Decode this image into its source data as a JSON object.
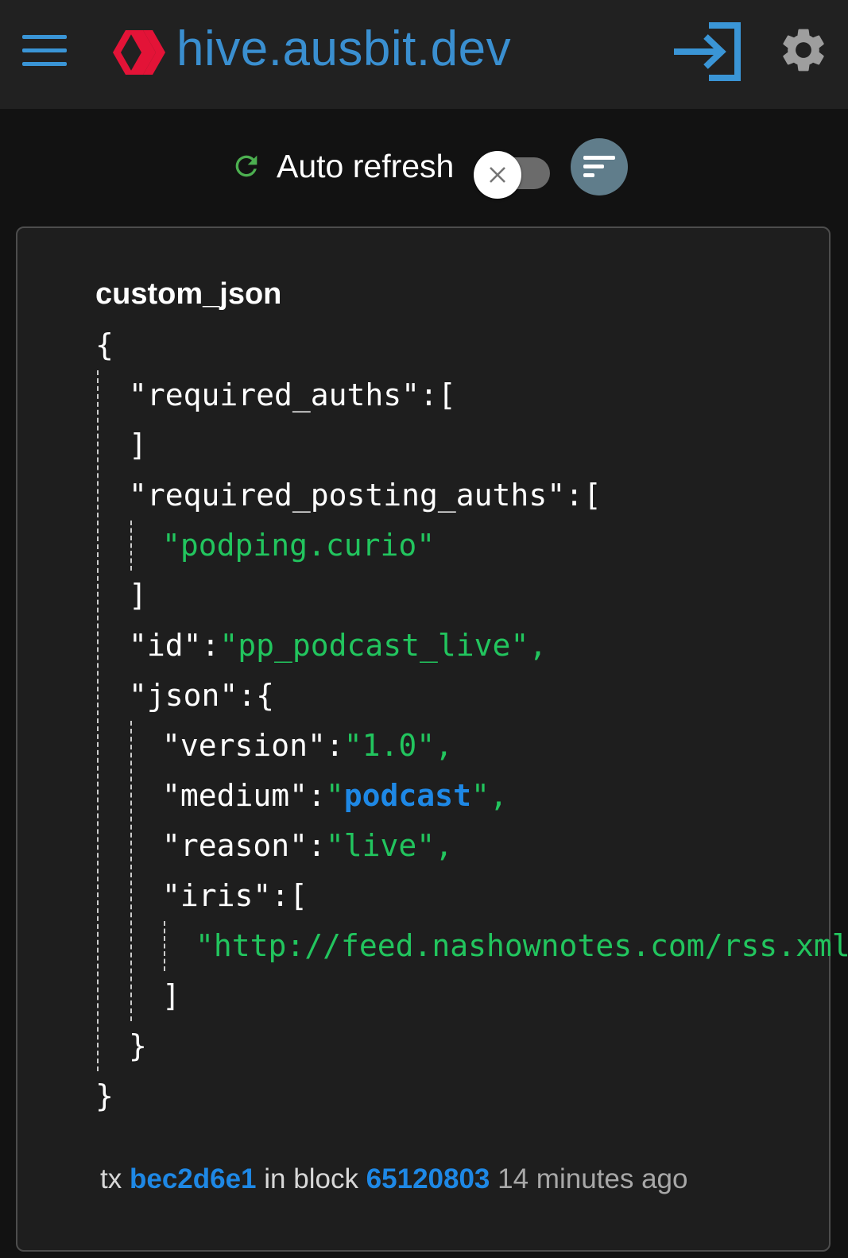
{
  "header": {
    "site_title": "hive.ausbit.dev",
    "icons": [
      "menu-icon",
      "hive-logo",
      "login-icon",
      "settings-icon"
    ],
    "accent_color": "#3a8fd0",
    "logo_color": "#e31337"
  },
  "toolbar": {
    "auto_refresh_label": "Auto refresh",
    "auto_refresh_on": false
  },
  "operation": {
    "type": "custom_json",
    "required_auths_key": "\"required_auths\":[",
    "required_posting_auths_key": "\"required_posting_auths\":[",
    "posting_auth_0": "\"podping.curio\"",
    "id_key": "\"id\":",
    "id_value": "\"pp_podcast_live\",",
    "json_key": "\"json\":{",
    "version_key": "\"version\":",
    "version_value": "\"1.0\",",
    "medium_key": "\"medium\":",
    "medium_quote_open": "\"",
    "medium_value": "podcast",
    "medium_quote_close": "\",",
    "reason_key": "\"reason\":",
    "reason_value": "\"live\",",
    "iris_key": "\"iris\":[",
    "iri_0": "\"http://feed.nashownotes.com/rss.xml\"",
    "open_brace": "{",
    "close_brace": "}",
    "close_bracket": "]"
  },
  "footer": {
    "tx_label": "tx",
    "tx_id": "bec2d6e1",
    "in_block_label": "in block",
    "block_num": "65120803",
    "time_ago": "14 minutes ago"
  }
}
